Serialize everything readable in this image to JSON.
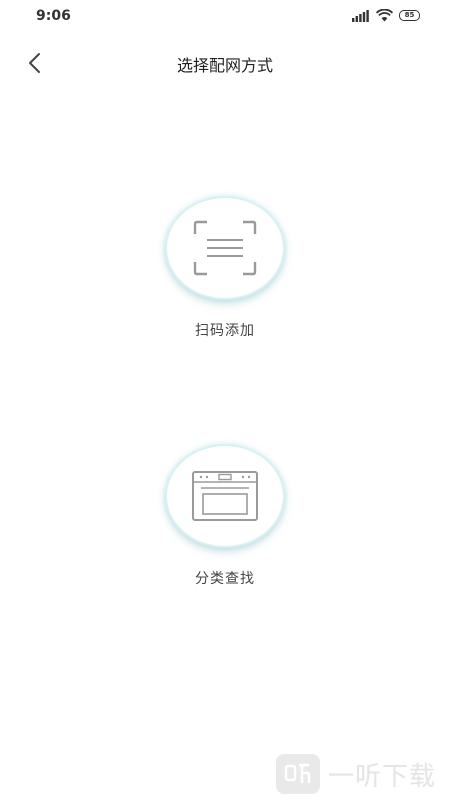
{
  "status_bar": {
    "time": "9:06",
    "battery": "85",
    "icons": [
      "signal-icon",
      "wifi-icon",
      "battery-icon"
    ]
  },
  "nav": {
    "back_icon": "chevron-left-icon",
    "title": "选择配网方式"
  },
  "options": [
    {
      "icon": "scan-qr-icon",
      "label": "扫码添加"
    },
    {
      "icon": "oven-icon",
      "label": "分类查找"
    }
  ],
  "watermark": {
    "text": "一听下载",
    "logo_glyph": "听"
  },
  "colors": {
    "background": "#ffffff",
    "circle_border": "#d8f1f3",
    "icon_gray": "#9a9a9a",
    "title_text": "#222222"
  }
}
